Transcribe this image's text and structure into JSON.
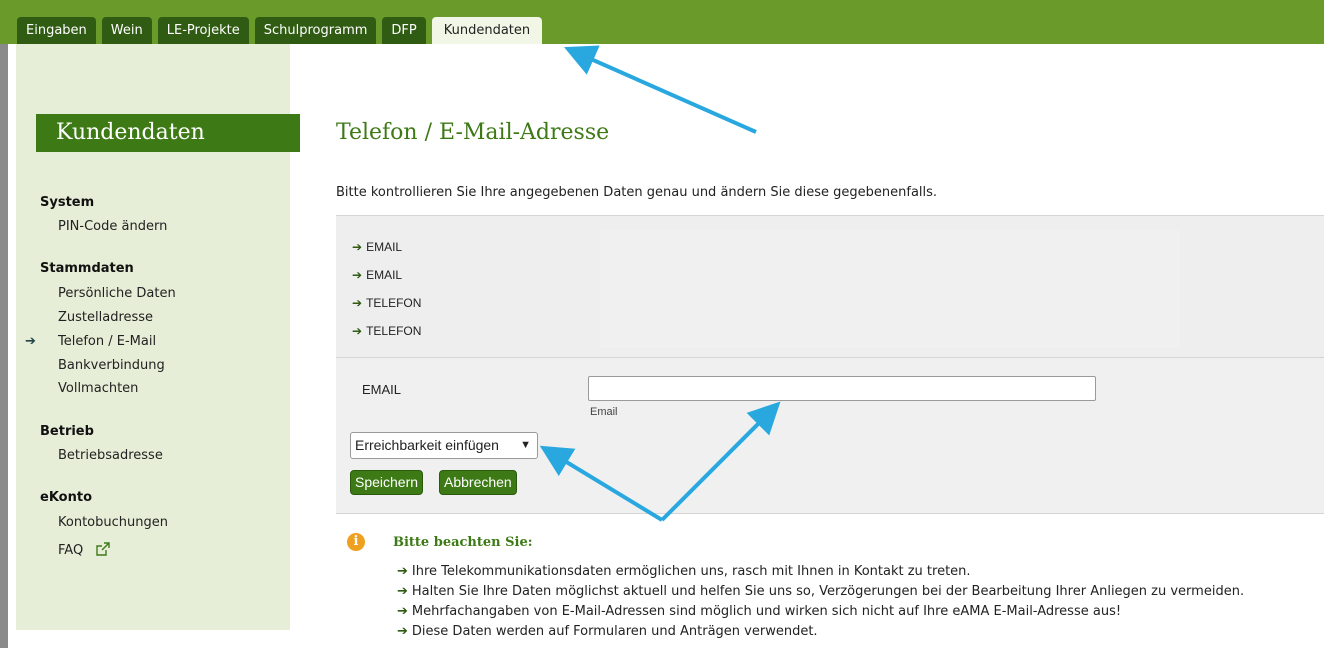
{
  "tabs": [
    "Eingaben",
    "Wein",
    "LE-Projekte",
    "Schulprogramm",
    "DFP",
    "Kundendaten"
  ],
  "active_tab": "Kundendaten",
  "sidebar": {
    "title": "Kundendaten",
    "sections": [
      {
        "heading": "System",
        "items": [
          "PIN-Code ändern"
        ]
      },
      {
        "heading": "Stammdaten",
        "items": [
          "Persönliche Daten",
          "Zustelladresse",
          "Telefon / E-Mail",
          "Bankverbindung",
          "Vollmachten"
        ]
      },
      {
        "heading": "Betrieb",
        "items": [
          "Betriebsadresse"
        ]
      },
      {
        "heading": "eKonto",
        "items": [
          "Kontobuchungen",
          "FAQ"
        ]
      }
    ],
    "current_item": "Telefon / E-Mail"
  },
  "main": {
    "title": "Telefon / E-Mail-Adresse",
    "intro": "Bitte kontrollieren Sie Ihre angegebenen Daten genau und ändern Sie diese gegebenenfalls.",
    "contacts": [
      "EMAIL",
      "EMAIL",
      "TELEFON",
      "TELEFON"
    ],
    "form": {
      "label": "EMAIL",
      "input_value": "",
      "hint": "Email",
      "select_value": "Erreichbarkeit einfügen",
      "save_label": "Speichern",
      "cancel_label": "Abbrechen"
    },
    "note": {
      "title": "Bitte beachten Sie:",
      "items": [
        "Ihre Telekommunikationsdaten ermöglichen uns, rasch mit Ihnen in Kontakt zu treten.",
        "Halten Sie Ihre Daten möglichst aktuell und helfen Sie uns so, Verzögerungen bei der Bearbeitung Ihrer Anliegen zu vermeiden.",
        "Mehrfachangaben von E-Mail-Adressen sind möglich und wirken sich nicht auf Ihre eAMA E-Mail-Adresse aus!",
        "Diese Daten werden auf Formularen und Anträgen verwendet."
      ]
    }
  },
  "colors": {
    "brand_green": "#3d7a16",
    "topbar": "#6a9a2a",
    "sidebar_bg": "#e6eed7",
    "annotation_arrow": "#29a8e0",
    "info_icon": "#f0a020"
  },
  "icons": [
    "arrow-right-icon",
    "external-link-icon",
    "info-icon",
    "chevron-down-icon"
  ]
}
